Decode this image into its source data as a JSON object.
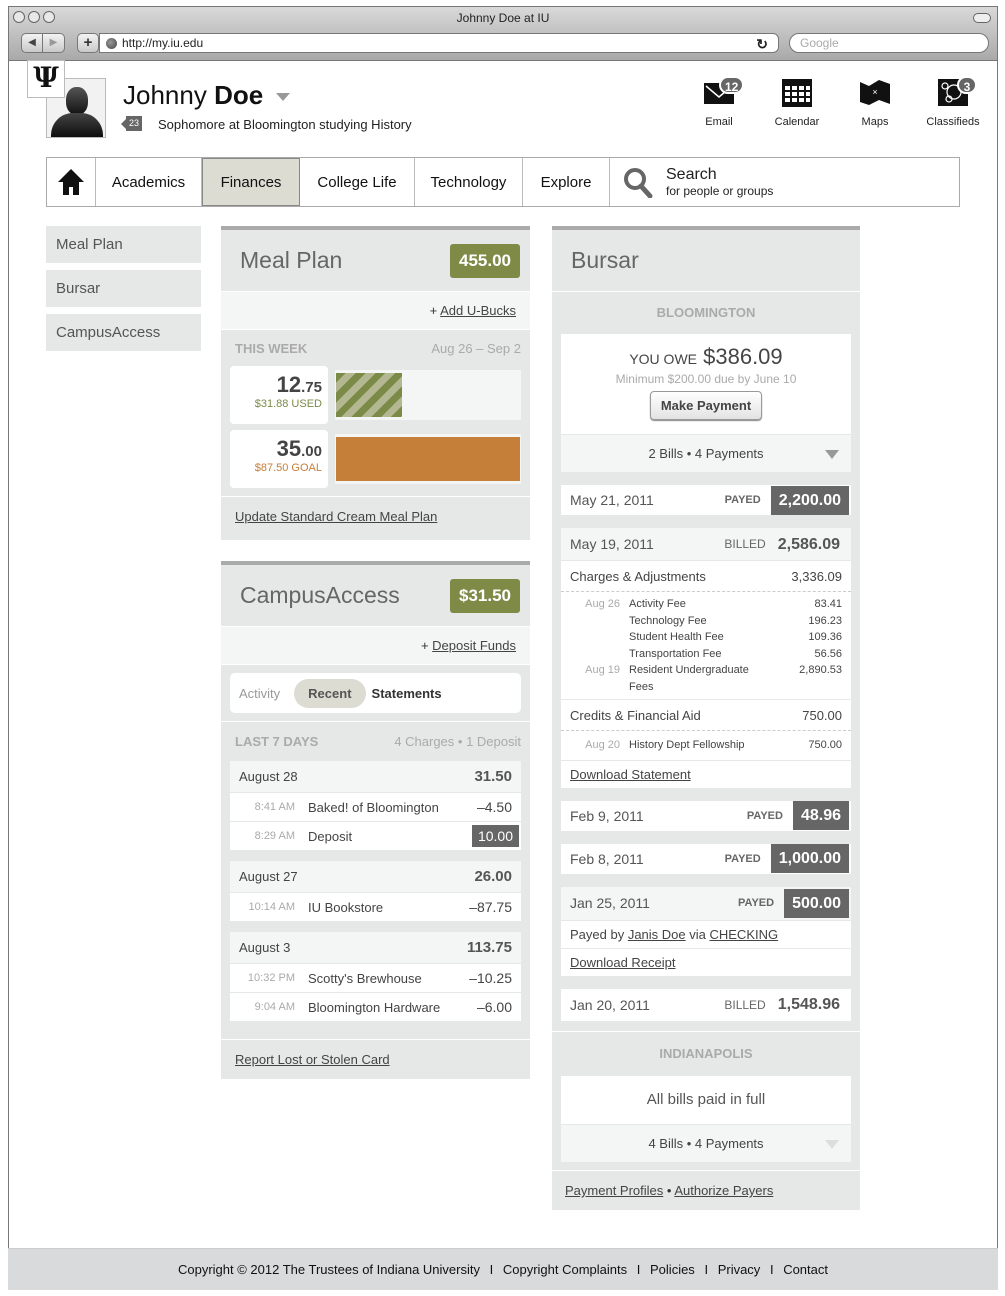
{
  "browser": {
    "window_title": "Johnny Doe at IU",
    "url": "http://my.iu.edu",
    "search_placeholder": "Google"
  },
  "header": {
    "logo": "Ψ",
    "first_name": "Johnny",
    "last_name": "Doe",
    "age": "23",
    "subtitle": "Sophomore at Bloomington studying History",
    "apps": [
      {
        "label": "Email",
        "icon": "envelope-icon",
        "count": "12"
      },
      {
        "label": "Calendar",
        "icon": "calendar-icon",
        "count": null
      },
      {
        "label": "Maps",
        "icon": "map-icon",
        "count": null
      },
      {
        "label": "Classifieds",
        "icon": "classifieds-icon",
        "count": "3"
      }
    ]
  },
  "nav": {
    "home_icon": "home-icon",
    "items": [
      "Academics",
      "Finances",
      "College Life",
      "Technology",
      "Explore"
    ],
    "active": "Finances",
    "search_title": "Search",
    "search_sub": "for people or groups"
  },
  "sidebar": {
    "items": [
      "Meal Plan",
      "Bursar",
      "CampusAccess"
    ]
  },
  "meal_plan": {
    "title": "Meal Plan",
    "balance": "455.00",
    "action_prefix": "+ ",
    "action": "Add U-Bucks",
    "week_label": "THIS WEEK",
    "week_range": "Aug 26 – Sep 2",
    "used_whole": "12",
    "used_frac": ".75",
    "used_sub": "$31.88 USED",
    "used_fraction": 0.364,
    "goal_whole": "35",
    "goal_frac": ".00",
    "goal_sub": "$87.50 GOAL",
    "goal_fraction": 1.0,
    "used_color": "#7c8a48",
    "goal_color": "#c67f39",
    "footer_link": "Update Standard Cream Meal Plan"
  },
  "campus_access": {
    "title": "CampusAccess",
    "balance": "$31.50",
    "action_prefix": "+ ",
    "action": "Deposit Funds",
    "tabs": [
      "Activity",
      "Recent",
      "Statements"
    ],
    "active_tab": "Recent",
    "period_label": "LAST 7 DAYS",
    "period_summary": "4 Charges • 1 Deposit",
    "groups": [
      {
        "date": "August 28",
        "total": "31.50",
        "items": [
          {
            "time": "8:41 AM",
            "desc": "Baked! of Bloomington",
            "amount": "–4.50",
            "deposit": false
          },
          {
            "time": "8:29 AM",
            "desc": "Deposit",
            "amount": "10.00",
            "deposit": true
          }
        ]
      },
      {
        "date": "August 27",
        "total": "26.00",
        "items": [
          {
            "time": "10:14 AM",
            "desc": "IU Bookstore",
            "amount": "–87.75",
            "deposit": false
          }
        ]
      },
      {
        "date": "August 3",
        "total": "113.75",
        "items": [
          {
            "time": "10:32 PM",
            "desc": "Scotty's Brewhouse",
            "amount": "–10.25",
            "deposit": false
          },
          {
            "time": "9:04 AM",
            "desc": "Bloomington Hardware",
            "amount": "–6.00",
            "deposit": false
          }
        ]
      }
    ],
    "footer_link": "Report Lost or Stolen Card"
  },
  "bursar": {
    "title": "Bursar",
    "bloomington": {
      "label": "BLOOMINGTON",
      "owe_label": "You owe",
      "owe_amount": "$386.09",
      "minimum": "Minimum $200.00 due by June 10",
      "pay_button": "Make Payment",
      "summary": "2 Bills • 4 Payments",
      "entries": [
        {
          "date": "May 21, 2011",
          "kind": "PAYED",
          "amount": "2,200.00"
        },
        {
          "date": "May 19, 2011",
          "kind": "BILLED",
          "amount": "2,586.09",
          "charges_label": "Charges & Adjustments",
          "charges_total": "3,336.09",
          "charges": [
            {
              "date": "Aug 26",
              "name": "Activity Fee",
              "amount": "83.41"
            },
            {
              "date": "",
              "name": "Technology Fee",
              "amount": "196.23"
            },
            {
              "date": "",
              "name": "Student Health Fee",
              "amount": "109.36"
            },
            {
              "date": "",
              "name": "Transportation Fee",
              "amount": "56.56"
            },
            {
              "date": "Aug 19",
              "name": "Resident Undergraduate Fees",
              "amount": "2,890.53"
            }
          ],
          "credits_label": "Credits & Financial Aid",
          "credits_total": "750.00",
          "credits": [
            {
              "date": "Aug 20",
              "name": "History Dept Fellowship",
              "amount": "750.00"
            }
          ],
          "download": "Download Statement"
        },
        {
          "date": "Feb 9, 2011",
          "kind": "PAYED",
          "amount": "48.96"
        },
        {
          "date": "Feb 8, 2011",
          "kind": "PAYED",
          "amount": "1,000.00"
        },
        {
          "date": "Jan 25, 2011",
          "kind": "PAYED",
          "amount": "500.00",
          "payer_prefix": "Payed by ",
          "payer": "Janis Doe",
          "via": " via ",
          "method": "CHECKING",
          "download": "Download Receipt"
        },
        {
          "date": "Jan 20, 2011",
          "kind": "BILLED",
          "amount": "1,548.96"
        }
      ]
    },
    "indianapolis": {
      "label": "INDIANAPOLIS",
      "status": "All bills paid in full",
      "summary": "4 Bills • 4 Payments"
    },
    "footer_links": [
      "Payment Profiles",
      "Authorize Payers"
    ],
    "footer_sep": " • "
  },
  "footer": {
    "items": [
      "Copyright © 2012 The Trustees of Indiana University",
      "Copyright Complaints",
      "Policies",
      "Privacy",
      "Contact"
    ],
    "sep": "I"
  }
}
